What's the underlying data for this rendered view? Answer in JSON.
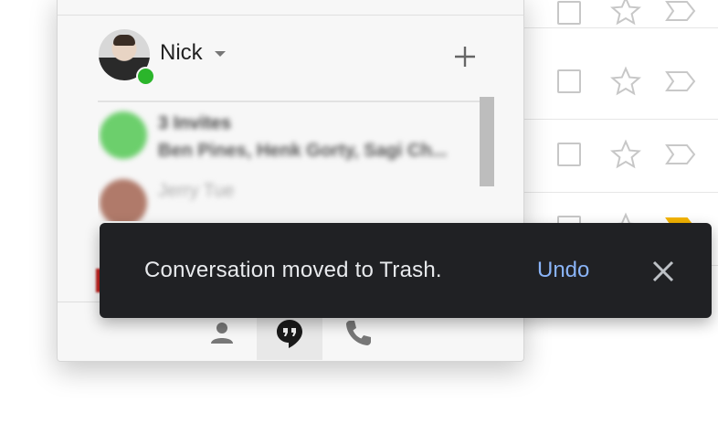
{
  "mail_list": {
    "row_count": 5,
    "checkbox_state": "unchecked",
    "star_state": "unstarred",
    "importance_marker_colors": [
      "#c8c8c8",
      "#c8c8c8",
      "#c8c8c8",
      "#f4b400"
    ]
  },
  "hangouts": {
    "user": {
      "name": "Nick",
      "status": "online",
      "status_color": "#2bb52b"
    },
    "add_icon": "plus-icon",
    "conversations": [
      {
        "title": "3 Invites",
        "subtitle": "Ben Pines, Henk Gorty, Sagi Ch...",
        "avatar_color": "#6ccf6c"
      },
      {
        "title": "Jerry Tue",
        "subtitle": "",
        "avatar_color": "#b07a6a"
      }
    ],
    "bottom_tabs": [
      {
        "icon": "person-icon",
        "active": false
      },
      {
        "icon": "hangouts-quote-icon",
        "active": true
      },
      {
        "icon": "phone-icon",
        "active": false
      }
    ]
  },
  "snackbar": {
    "message": "Conversation moved to Trash.",
    "action_label": "Undo",
    "action_color": "#8ab4f8",
    "close_icon": "close-icon"
  }
}
